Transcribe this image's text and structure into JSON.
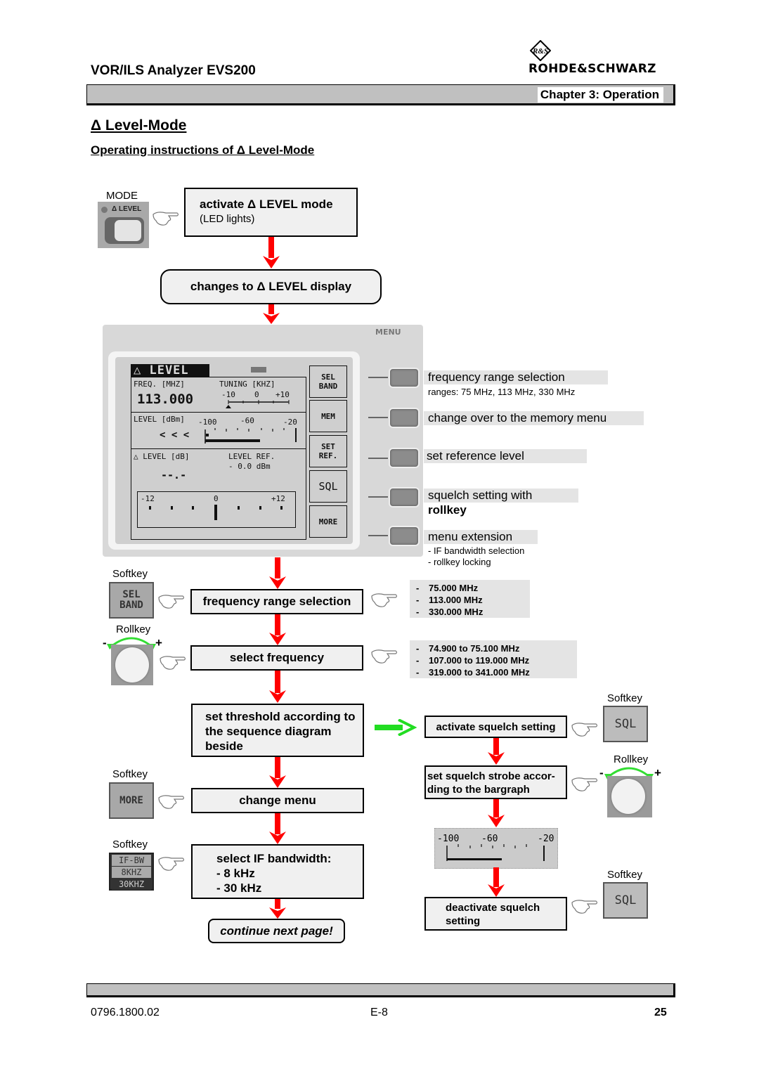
{
  "header": {
    "doc_title": "VOR/ILS Analyzer EVS200",
    "brand": "ROHDE&SCHWARZ",
    "brand_mark": "R&S",
    "chapter": "Chapter 3: Operation"
  },
  "section": {
    "title": "Δ Level-Mode",
    "subtitle": "Operating instructions of Δ Level-Mode"
  },
  "mode_key": {
    "caption": "MODE",
    "label": "Δ LEVEL"
  },
  "flow": {
    "activate_title": "activate Δ LEVEL mode",
    "activate_sub": "(LED lights)",
    "changes_to": "changes to  Δ LEVEL display",
    "freq_range": "frequency range selection",
    "select_freq": "select frequency",
    "threshold": "set threshold according to the sequence diagram beside",
    "change_menu": "change menu",
    "if_bw_title": "select IF bandwidth:",
    "if_bw_opt1": "-  8 kHz",
    "if_bw_opt2": "- 30 kHz",
    "continue": "continue next page!"
  },
  "display": {
    "menu_label": "MENU",
    "title": "△ LEVEL",
    "freq_label": "FREQ. [MHZ]",
    "freq_value": "113.000",
    "tuning_label": "TUNING [KHZ]",
    "tuning_ticks": [
      "-10",
      "0",
      "+10"
    ],
    "level_label": "LEVEL [dBm]",
    "level_ticks": [
      "-100",
      "-60",
      "-20"
    ],
    "level_indicator": "< < <",
    "dlevel_label": "△ LEVEL  [dB]",
    "dlevel_value": "--.-",
    "level_ref_label": "LEVEL REF.",
    "level_ref_value": "- 0.0  dBm",
    "delta_ticks": [
      "-12",
      "0",
      "+12"
    ],
    "softkeys": [
      "SEL BAND",
      "MEM",
      "SET REF.",
      "SQL",
      "MORE"
    ]
  },
  "annotations": [
    {
      "title": "frequency range selection",
      "detail": "ranges:  75 MHz, 113 MHz, 330 MHz"
    },
    {
      "title": "change over to the memory menu",
      "detail": ""
    },
    {
      "title": "set reference level",
      "detail": ""
    },
    {
      "title": "squelch setting with",
      "detail_bold": "rollkey"
    },
    {
      "title": "menu extension",
      "detail_lines": [
        "- IF bandwidth selection",
        "- rollkey locking"
      ]
    }
  ],
  "freq_ranges": [
    "75.000 MHz",
    "113.000 MHz",
    "330.000 MHz"
  ],
  "freq_spans": [
    "74.900 to 75.100 MHz",
    "107.000 to 119.000 MHz",
    "319.000 to 341.000 MHz"
  ],
  "controls": {
    "softkey_caption": "Softkey",
    "rollkey_caption": "Rollkey",
    "minus": "-",
    "plus": "+",
    "sel_band": "SEL BAND",
    "more": "MORE",
    "sql": "SQL",
    "ifbw_lines": [
      "IF-BW",
      "8KHZ",
      "30KHZ"
    ]
  },
  "squelch_flow": {
    "activate": "activate squelch setting",
    "set_strobe": "set squelch strobe accor-ding  to the bargraph",
    "bargraph_ticks": [
      "-100",
      "-60",
      "-20"
    ],
    "deactivate": "deactivate squelch setting"
  },
  "footer": {
    "doc_number": "0796.1800.02",
    "section_page": "E-8",
    "page_number": "25"
  },
  "colors": {
    "flow_arrow": "#ff0000",
    "branch_arrow": "#22dd22",
    "box_fill": "#f0f0f0",
    "band_fill": "#e4e4e4"
  }
}
